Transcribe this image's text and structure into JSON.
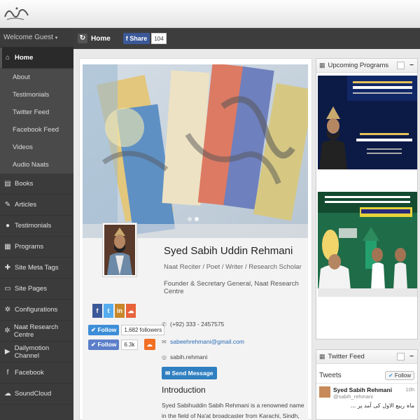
{
  "header": {
    "logo_text": "صبیح رحمانی"
  },
  "sidebar": {
    "welcome": "Welcome Guest",
    "items": [
      {
        "label": "Home",
        "icon": "home-icon",
        "glyph": "⌂",
        "active": true
      },
      {
        "label": "Books",
        "icon": "book-icon",
        "glyph": "▤"
      },
      {
        "label": "Articles",
        "icon": "article-icon",
        "glyph": "✎"
      },
      {
        "label": "Testimonials",
        "icon": "speech-icon",
        "glyph": "●"
      },
      {
        "label": "Programs",
        "icon": "calendar-icon",
        "glyph": "▦"
      },
      {
        "label": "Site Meta Tags",
        "icon": "tag-icon",
        "glyph": "✚"
      },
      {
        "label": "Site Pages",
        "icon": "pages-icon",
        "glyph": "▭"
      },
      {
        "label": "Configurations",
        "icon": "gear-icon",
        "glyph": "✲"
      },
      {
        "label": "Naat Research Centre",
        "icon": "gear-icon",
        "glyph": "✲"
      },
      {
        "label": "Dailymotion Channel",
        "icon": "video-icon",
        "glyph": "▶"
      },
      {
        "label": "Facebook",
        "icon": "facebook-icon",
        "glyph": "f"
      },
      {
        "label": "SoundCloud",
        "icon": "soundcloud-icon",
        "glyph": "☁"
      }
    ],
    "sub_items": [
      "About",
      "Testimonials",
      "Twitter Feed",
      "Facebook Feed",
      "Videos",
      "Audio Naats"
    ]
  },
  "page_header": {
    "home_label": "Home",
    "share_label": "Share",
    "share_count": "104"
  },
  "profile": {
    "name": "Syed Sabih Uddin Rehmani",
    "role": "Naat Reciter / Poet / Writer / Research Scholar",
    "position": "Founder & Secretary General, Naat Research Centre",
    "phone": "(+92) 333 - 2457575",
    "email": "sabeehrehmani@gmail.com",
    "skype": "sabih.rehmani",
    "message_button": "Send Message",
    "intro_title": "Introduction",
    "intro_text": "Syed Sabihuddin Sabih Rehmani is a renowned name in the field of Na'at broadcaster from Karachi, Sindh, Pakistan. His Naat has been admired",
    "socials": [
      {
        "label": "f",
        "color": "#3b5998",
        "name": "facebook-icon"
      },
      {
        "label": "t",
        "color": "#55acee",
        "name": "twitter-icon"
      },
      {
        "label": "in",
        "color": "#c8872a",
        "name": "linkedin-icon"
      },
      {
        "label": "☁",
        "color": "#e8623a",
        "name": "soundcloud-icon"
      }
    ],
    "twitter_follow": "Follow",
    "twitter_followers": "1,682 followers",
    "follow2": "Follow",
    "follow2_count": "6.3k"
  },
  "widgets": {
    "upcoming_title": "Upcoming Programs",
    "twitter_title": "Twitter Feed",
    "tweets_label": "Tweets",
    "follow_label": "Follow",
    "tweet_name": "Syed Sabih Rehmani",
    "tweet_handle": "@sabih_rehmani",
    "tweet_time": "10h",
    "tweet_text": "ماہ ربیع الاول کی آمد پر ..."
  },
  "colors": {
    "sidebar_bg": "#3b3b3b",
    "header_bg": "#3d3d3d",
    "facebook": "#3b5998",
    "twitter": "#3d8ed8",
    "soundcloud": "#f26f23"
  }
}
